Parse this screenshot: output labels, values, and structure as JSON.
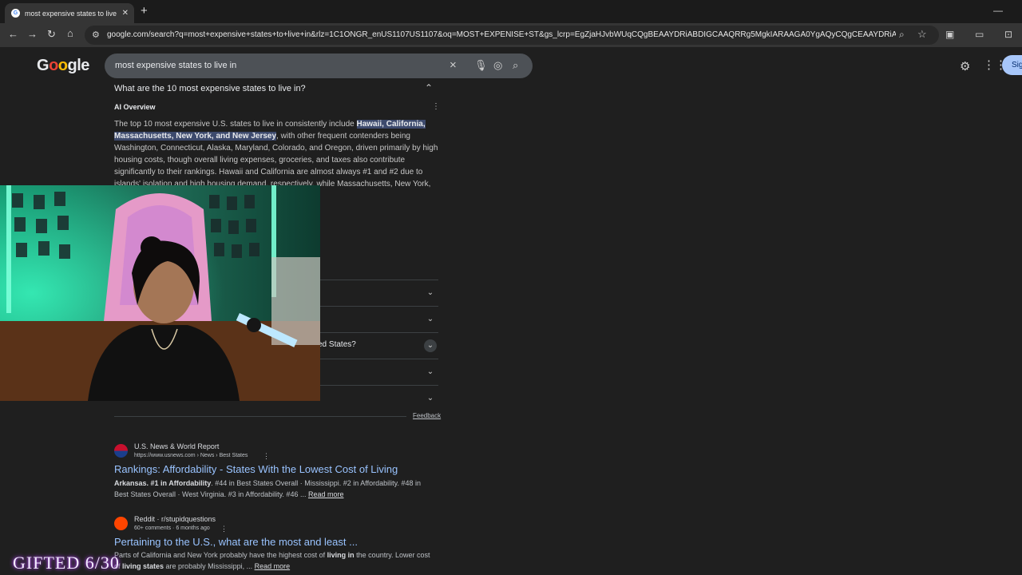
{
  "browser": {
    "tab_title": "most expensive states to live in",
    "tab_close": "✕",
    "new_tab": "+",
    "minimize": "—",
    "url": "google.com/search?q=most+expensive+states+to+live+in&rlz=1C1ONGR_enUS1107US1107&oq=MOST+EXPENISE+ST&gs_lcrp=EgZjaHJvbWUqCQgBEAAYDRiABDIGCAAQRRg5MgkIARAAGA0YgAQyCQgCEAAYDRiABDIMCAMQ..."
  },
  "google": {
    "logo_text": "Google",
    "query": "most expensive states to live in",
    "signin_label": "Sig"
  },
  "ai": {
    "question": "What are the 10 most expensive states to live in?",
    "overview_label": "AI Overview",
    "para_intro": "The top 10 most expensive U.S. states to live in consistently include ",
    "para_highlight_1": "Hawaii, California,",
    "para_highlight_2": "Massachusetts, New York, and New Jersey",
    "para_rest": ", with other frequent contenders being Washington, Connecticut, Alaska, Maryland, Colorado, and Oregon, driven primarily by high housing costs, though overall living expenses, groceries, and taxes also contribute significantly to their rankings. Hawaii and California are almost always #1 and #2 due to islands' isolation and high housing demand, respectively, while Massachusetts, New York,"
  },
  "paa": {
    "row3_visible_text": "ed States?",
    "feedback": "Feedback"
  },
  "results": [
    {
      "site": "U.S. News & World Report",
      "url": "https://www.usnews.com › News › Best States",
      "title": "Rankings: Affordability - States With the Lowest Cost of Living",
      "snippet_bold": "Arkansas. #1 in Affordability",
      "snippet": ". #44 in Best States Overall · Mississippi. #2 in Affordability. #48 in Best States Overall · West Virginia. #3 in Affordability. #46 ... ",
      "read_more": "Read more"
    },
    {
      "site": "Reddit · r/stupidquestions",
      "url": "60+ comments · 6 months ago",
      "title": "Pertaining to the U.S., what are the most and least ...",
      "snippet_a": "Parts of California and New York probably have the highest cost of ",
      "snippet_bold_a": "living in",
      "snippet_b": " the country. Lower cost of ",
      "snippet_bold_b": "living states",
      "snippet_c": " are probably Mississippi, ... ",
      "read_more": "Read more"
    }
  ],
  "overlay": {
    "gifted": "GIFTED 6/30"
  },
  "colors": {
    "page_bg": "#1f1f1f",
    "link": "#99c3ff",
    "highlight": "#3d4a6d",
    "signin": "#a8c7fa"
  }
}
